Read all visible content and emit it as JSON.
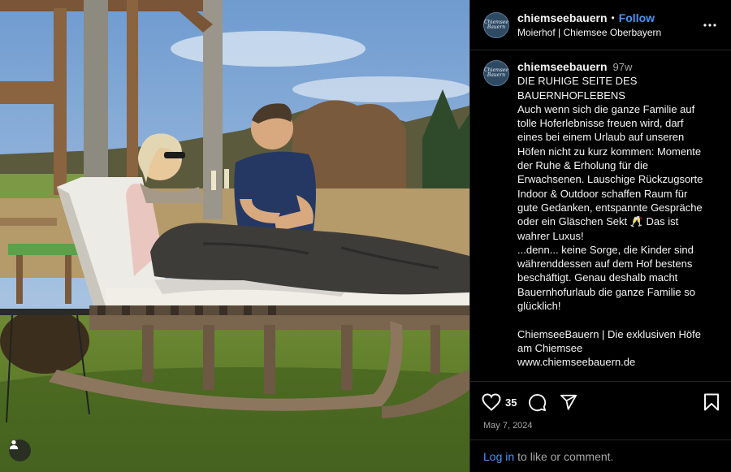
{
  "post": {
    "username": "chiemseebauern",
    "separator": "•",
    "follow_label": "Follow",
    "location": "Moierhof | Chiemsee Oberbayern",
    "avatar_text": "Chiemsee Bauern",
    "more_icon": "more-horizontal-icon"
  },
  "caption": {
    "username": "chiemseebauern",
    "time": "97w",
    "lines": [
      "DIE RUHIGE SEITE DES",
      "BAUERNHOFLEBENS",
      "Auch wenn sich die ganze Familie auf",
      "tolle Hoferlebnisse freuen wird, darf",
      "eines bei einem Urlaub auf unseren",
      "Höfen nicht zu kurz kommen: Momente",
      "der Ruhe & Erholung für die",
      "Erwachsenen. Lauschige Rückzugsorte",
      "Indoor & Outdoor schaffen Raum für",
      "gute Gedanken, entspannte Gespräche",
      "oder ein Gläschen Sekt 🥂 Das ist",
      "wahrer Luxus!",
      "...denn... keine Sorge, die Kinder sind",
      "währenddessen auf dem Hof bestens",
      "beschäftigt. Genau deshalb macht",
      "Bauernhofurlaub die ganze Familie so",
      "glücklich!",
      "",
      "ChiemseeBauern | Die exklusiven Höfe",
      "am Chiemsee",
      "www.chiemseebauern.de"
    ]
  },
  "actions": {
    "like_count": "35",
    "date": "May 7, 2024"
  },
  "footer": {
    "login_label": "Log in",
    "rest_label": "to like or comment."
  },
  "colors": {
    "accent": "#4a95f6",
    "background": "#000000",
    "muted": "#a8a8a8",
    "divider": "#262626"
  }
}
